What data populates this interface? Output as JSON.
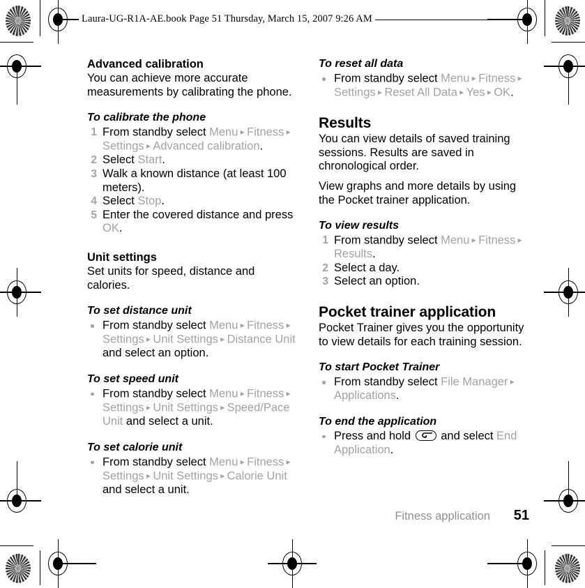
{
  "header": {
    "file_info": "Laura-UG-R1A-AE.book  Page 51  Thursday, March 15, 2007  9:26 AM"
  },
  "footer": {
    "chapter": "Fitness application",
    "page_number": "51"
  },
  "left_column": {
    "advanced_calibration": {
      "heading": "Advanced calibration",
      "body": "You can achieve more accurate measurements by calibrating the phone.",
      "procedure_title": "To calibrate the phone",
      "steps": [
        {
          "number": "1",
          "parts": [
            {
              "text": "From standby select ",
              "style": "plain"
            },
            {
              "text": "Menu",
              "style": "ui"
            },
            {
              "text": "▸",
              "style": "arrow"
            },
            {
              "text": "Fitness",
              "style": "ui"
            },
            {
              "text": "▸",
              "style": "arrow"
            },
            {
              "text": "Settings",
              "style": "ui"
            },
            {
              "text": "▸",
              "style": "arrow"
            },
            {
              "text": "Advanced calibration",
              "style": "ui"
            },
            {
              "text": ".",
              "style": "plain"
            }
          ]
        },
        {
          "number": "2",
          "parts": [
            {
              "text": "Select ",
              "style": "plain"
            },
            {
              "text": "Start",
              "style": "ui"
            },
            {
              "text": ".",
              "style": "plain"
            }
          ]
        },
        {
          "number": "3",
          "parts": [
            {
              "text": "Walk a known distance (at least 100 meters).",
              "style": "plain"
            }
          ]
        },
        {
          "number": "4",
          "parts": [
            {
              "text": "Select ",
              "style": "plain"
            },
            {
              "text": "Stop",
              "style": "ui"
            },
            {
              "text": ".",
              "style": "plain"
            }
          ]
        },
        {
          "number": "5",
          "parts": [
            {
              "text": "Enter the covered distance and press ",
              "style": "plain"
            },
            {
              "text": "OK",
              "style": "ui"
            },
            {
              "text": ".",
              "style": "plain"
            }
          ]
        }
      ]
    },
    "unit_settings": {
      "heading": "Unit settings",
      "body": "Set units for speed, distance and calories.",
      "procedures": [
        {
          "title": "To set distance unit",
          "bullets": [
            {
              "parts": [
                {
                  "text": "From standby select ",
                  "style": "plain"
                },
                {
                  "text": "Menu",
                  "style": "ui"
                },
                {
                  "text": "▸",
                  "style": "arrow"
                },
                {
                  "text": "Fitness",
                  "style": "ui"
                },
                {
                  "text": "▸",
                  "style": "arrow"
                },
                {
                  "text": "Settings",
                  "style": "ui"
                },
                {
                  "text": "▸",
                  "style": "arrow"
                },
                {
                  "text": "Unit Settings",
                  "style": "ui"
                },
                {
                  "text": "▸",
                  "style": "arrow"
                },
                {
                  "text": "Distance Unit",
                  "style": "ui"
                },
                {
                  "text": " and select an option.",
                  "style": "plain"
                }
              ]
            }
          ]
        },
        {
          "title": "To set speed unit",
          "bullets": [
            {
              "parts": [
                {
                  "text": "From standby select ",
                  "style": "plain"
                },
                {
                  "text": "Menu",
                  "style": "ui"
                },
                {
                  "text": "▸",
                  "style": "arrow"
                },
                {
                  "text": "Fitness",
                  "style": "ui"
                },
                {
                  "text": "▸",
                  "style": "arrow"
                },
                {
                  "text": "Settings",
                  "style": "ui"
                },
                {
                  "text": "▸",
                  "style": "arrow"
                },
                {
                  "text": "Unit Settings",
                  "style": "ui"
                },
                {
                  "text": "▸",
                  "style": "arrow"
                },
                {
                  "text": "Speed/Pace Unit",
                  "style": "ui"
                },
                {
                  "text": " and select a unit.",
                  "style": "plain"
                }
              ]
            }
          ]
        },
        {
          "title": "To set calorie unit",
          "bullets": [
            {
              "parts": [
                {
                  "text": "From standby select ",
                  "style": "plain"
                },
                {
                  "text": "Menu",
                  "style": "ui"
                },
                {
                  "text": "▸",
                  "style": "arrow"
                },
                {
                  "text": "Fitness",
                  "style": "ui"
                },
                {
                  "text": "▸",
                  "style": "arrow"
                },
                {
                  "text": "Settings",
                  "style": "ui"
                },
                {
                  "text": "▸",
                  "style": "arrow"
                },
                {
                  "text": "Unit Settings",
                  "style": "ui"
                },
                {
                  "text": "▸",
                  "style": "arrow"
                },
                {
                  "text": "Calorie Unit",
                  "style": "ui"
                },
                {
                  "text": " and select a unit.",
                  "style": "plain"
                }
              ]
            }
          ]
        }
      ]
    }
  },
  "right_column": {
    "reset_all_data": {
      "title": "To reset all data",
      "bullets": [
        {
          "parts": [
            {
              "text": "From standby select ",
              "style": "plain"
            },
            {
              "text": "Menu",
              "style": "ui"
            },
            {
              "text": "▸",
              "style": "arrow"
            },
            {
              "text": "Fitness",
              "style": "ui"
            },
            {
              "text": "▸",
              "style": "arrow"
            },
            {
              "text": "Settings",
              "style": "ui"
            },
            {
              "text": "▸",
              "style": "arrow"
            },
            {
              "text": "Reset All Data",
              "style": "ui"
            },
            {
              "text": "▸",
              "style": "arrow"
            },
            {
              "text": "Yes",
              "style": "ui"
            },
            {
              "text": "▸",
              "style": "arrow"
            },
            {
              "text": "OK",
              "style": "ui"
            },
            {
              "text": ".",
              "style": "plain"
            }
          ]
        }
      ]
    },
    "results": {
      "heading": "Results",
      "body1": "You can view details of saved training sessions. Results are saved in chronological order.",
      "body2": "View graphs and more details by using the Pocket trainer application.",
      "procedure_title": "To view results",
      "steps": [
        {
          "number": "1",
          "parts": [
            {
              "text": "From standby select ",
              "style": "plain"
            },
            {
              "text": "Menu",
              "style": "ui"
            },
            {
              "text": "▸",
              "style": "arrow"
            },
            {
              "text": "Fitness",
              "style": "ui"
            },
            {
              "text": "▸",
              "style": "arrow"
            },
            {
              "text": "Results",
              "style": "ui"
            },
            {
              "text": ".",
              "style": "plain"
            }
          ]
        },
        {
          "number": "2",
          "parts": [
            {
              "text": "Select a day.",
              "style": "plain"
            }
          ]
        },
        {
          "number": "3",
          "parts": [
            {
              "text": "Select an option.",
              "style": "plain"
            }
          ]
        }
      ]
    },
    "pocket_trainer": {
      "heading": "Pocket trainer application",
      "body": "Pocket Trainer gives you the opportunity to view details for each training session.",
      "procedures": [
        {
          "title": "To start Pocket Trainer",
          "bullets": [
            {
              "parts": [
                {
                  "text": "From standby select ",
                  "style": "plain"
                },
                {
                  "text": "File Manager",
                  "style": "ui"
                },
                {
                  "text": "▸",
                  "style": "arrow"
                },
                {
                  "text": "Applications",
                  "style": "ui"
                },
                {
                  "text": ".",
                  "style": "plain"
                }
              ]
            }
          ]
        },
        {
          "title": "To end the application",
          "bullets": [
            {
              "parts": [
                {
                  "text": "Press and hold ",
                  "style": "plain"
                },
                {
                  "text": "back-key",
                  "style": "key"
                },
                {
                  "text": " and select ",
                  "style": "plain"
                },
                {
                  "text": "End Application",
                  "style": "ui"
                },
                {
                  "text": ".",
                  "style": "plain"
                }
              ]
            }
          ]
        }
      ]
    }
  },
  "colors": {
    "ui_term": "#a2a2a2",
    "text": "#000000",
    "footer_label": "#8f8f8f"
  }
}
